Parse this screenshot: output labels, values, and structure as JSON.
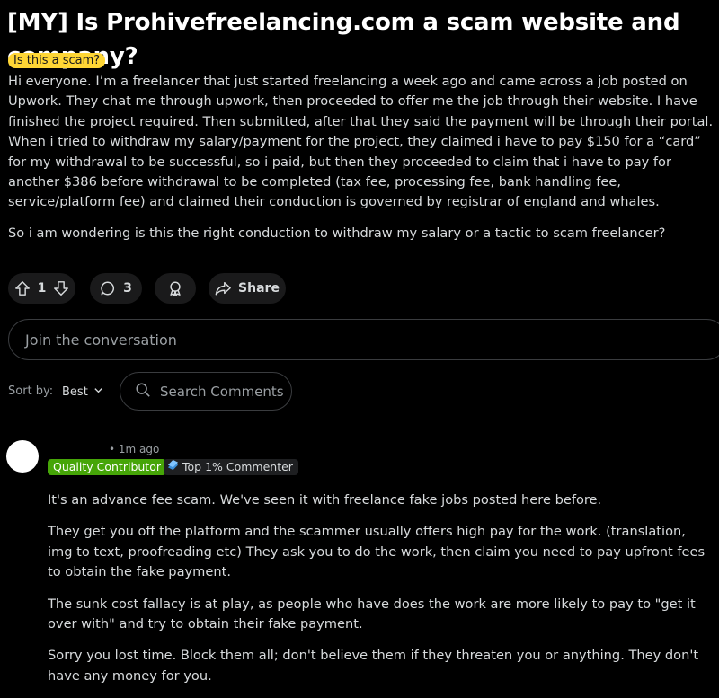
{
  "post": {
    "title": "[MY] Is Prohivefreelancing.com a scam website and company?",
    "flair": "Is this a scam?",
    "paragraphs": [
      "Hi everyone. I’m a freelancer that just started freelancing a week ago and came across a job posted on Upwork. They chat me through upwork, then proceeded to offer me the job through their website. I have finished the project required. Then submitted, after that they said the payment will be through their portal. When i tried to withdraw my salary/payment for the project, they claimed i have to pay $150 for a “card” for my withdrawal to be successful, so i paid, but then they proceeded to claim that i have to pay for another $386 before withdrawal to be completed (tax fee, processing fee, bank handling fee, service/platform fee) and claimed their conduction is governed by registrar of england and whales.",
      "So i am wondering is this the right conduction to withdraw my salary or a tactic to scam freelancer?"
    ]
  },
  "actions": {
    "vote_count": "1",
    "comment_count": "3",
    "share_label": "Share"
  },
  "join": {
    "placeholder": "Join the conversation"
  },
  "sort": {
    "label": "Sort by:",
    "value": "Best"
  },
  "search": {
    "placeholder": "Search Comments"
  },
  "comment": {
    "time": "• 1m ago",
    "badge_quality": "Quality Contributor",
    "badge_top": "Top 1% Commenter",
    "paragraphs": [
      "It's an advance fee scam. We've seen it with freelance fake jobs posted here before.",
      "They get you off the platform and the scammer usually offers high pay for the work. (translation, img to text, proofreading etc) They ask you to do the work, then claim you need to pay upfront fees to obtain the fake payment.",
      "The sunk cost fallacy is at play, as people who have does the work are more likely to pay to \"get it over with\" and try to obtain their fake payment.",
      "Sorry you lost time. Block them all; don't believe them if they threaten you or anything. They don't have any money for you."
    ]
  },
  "colors": {
    "background": "#000000",
    "text": "#D7DADC",
    "flair_bg": "#FFD635",
    "quality_badge": "#46A508",
    "pill_bg": "#1A1A1B"
  },
  "icons": [
    "upvote-icon",
    "downvote-icon",
    "comment-icon",
    "award-icon",
    "share-icon",
    "chevron-down-icon",
    "search-icon",
    "top-commenter-icon"
  ]
}
